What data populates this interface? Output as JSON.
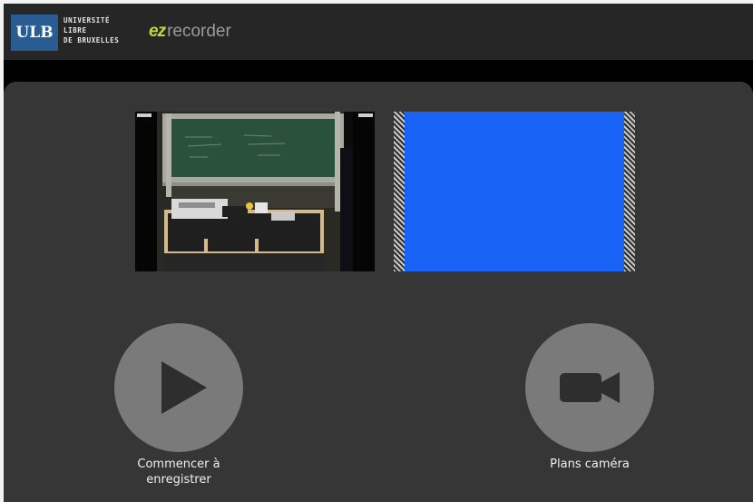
{
  "header": {
    "ulb_abbrev": "ULB",
    "ulb_lines": [
      "UNIVERSITÉ",
      "LIBRE",
      "DE BRUXELLES"
    ],
    "app_logo_mark": "ez",
    "app_logo_word": "recorder"
  },
  "colors": {
    "header_bg": "#262626",
    "panel_bg": "#363636",
    "ulb_blue": "#2a5c94",
    "ez_green": "#c7d63c",
    "slide_blue": "#1962f6",
    "button_gray": "#7a7a7a"
  },
  "previews": {
    "camera": {
      "icon": "classroom-camera-feed"
    },
    "slides": {
      "icon": "slide-feed-blank"
    }
  },
  "actions": {
    "record": {
      "label_line1": "Commencer à",
      "label_line2": "enregistrer",
      "icon": "play-icon"
    },
    "camera": {
      "label": "Plans caméra",
      "icon": "video-camera-icon"
    }
  }
}
